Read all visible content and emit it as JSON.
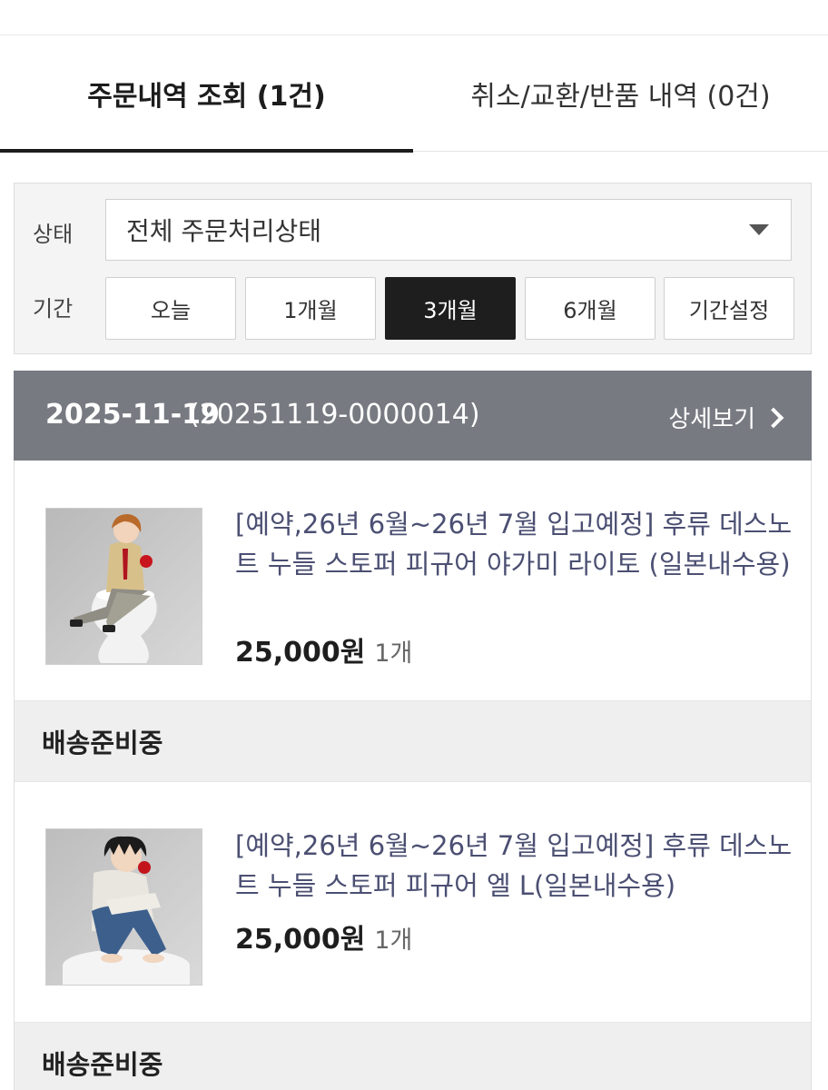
{
  "tabs": [
    {
      "label": "주문내역 조회 (1건)",
      "active": true
    },
    {
      "label": "취소/교환/반품 내역 (0건)",
      "active": false
    }
  ],
  "filter": {
    "status_label": "상태",
    "status_value": "전체 주문처리상태",
    "period_label": "기간",
    "periods": [
      "오늘",
      "1개월",
      "3개월",
      "6개월",
      "기간설정"
    ],
    "active_period": "3개월"
  },
  "order": {
    "date": "2025-11-19",
    "number": "(20251119-0000014)",
    "detail_label": "상세보기",
    "items": [
      {
        "title": "[예약,26년 6월~26년 7월 입고예정] 후류 데스노트 누들 스토퍼 피규어 야가미 라이토 (일본내수용)",
        "price": "25,000원",
        "qty": "1개",
        "status": "배송준비중"
      },
      {
        "title": "[예약,26년 6월~26년 7월 입고예정] 후류 데스노트 누들 스토퍼 피규어 엘 L(일본내수용)",
        "price": "25,000원",
        "qty": "1개",
        "status": "배송준비중"
      }
    ]
  },
  "colors": {
    "order_header_bg": "#777a81",
    "active_tab_underline": "#1c1c1c",
    "active_period_bg": "#1e1e1e",
    "item_title": "#4b4f72"
  }
}
